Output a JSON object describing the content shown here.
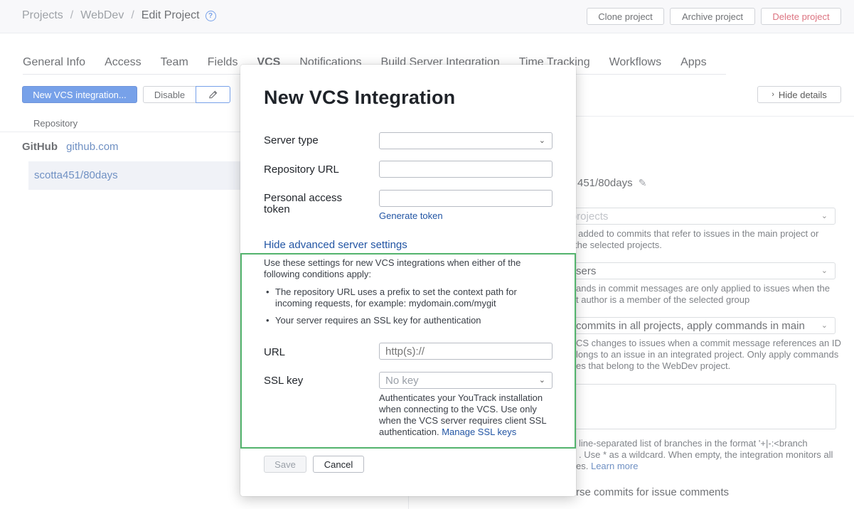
{
  "breadcrumb": {
    "projects": "Projects",
    "project": "WebDev",
    "current": "Edit Project"
  },
  "top_actions": {
    "clone": "Clone project",
    "archive": "Archive project",
    "delete": "Delete project"
  },
  "tabs": [
    "General Info",
    "Access",
    "Team",
    "Fields",
    "VCS",
    "Notifications",
    "Build Server Integration",
    "Time Tracking",
    "Workflows",
    "Apps"
  ],
  "toolbar": {
    "new_vcs": "New VCS integration...",
    "disable": "Disable",
    "hide_details": "Hide details"
  },
  "repo_list": {
    "header": "Repository",
    "group_name": "GitHub",
    "group_host": "github.com",
    "selected_repo": "scotta451/80days"
  },
  "details": {
    "repo_name_partial": "451/80days",
    "projects_placeholder": "ct projects",
    "projects_help_1": "re added to commits that refer to issues in the main project or",
    "projects_help_2": "the selected projects.",
    "users_value": "sers",
    "users_help_1": "ands in commit messages are only applied to issues when the",
    "users_help_2": "t author is a member of the selected group",
    "commits_value": "commits in all projects, apply commands in main",
    "commits_help_1": "CS changes to issues when a commit message references an ID",
    "commits_help_2": "longs to an issue in an integrated project. Only apply commands",
    "commits_help_3": "es that belong to the WebDev project.",
    "branches_help_1": "line-separated list of branches in the format '+|-:<branch",
    "branches_help_2": ". Use * as a wildcard. When empty, the integration monitors all",
    "branches_help_3": "es.",
    "learn_more": "Learn more",
    "parse_commits": "rse commits for issue comments"
  },
  "dialog": {
    "title": "New VCS Integration",
    "server_type_label": "Server type",
    "server_type_value": "",
    "repo_url_label": "Repository URL",
    "repo_url_value": "",
    "token_label": "Personal access token",
    "token_value": "",
    "generate_token": "Generate token",
    "hide_advanced": "Hide advanced server settings",
    "advanced_desc": "Use these settings for new VCS integrations when either of the following conditions apply:",
    "bullets": [
      "The repository URL uses a prefix to set the context path for incoming requests, for example: mydomain.com/mygit",
      "Your server requires an SSL key for authentication"
    ],
    "url_label": "URL",
    "url_placeholder": "http(s)://",
    "ssl_label": "SSL key",
    "ssl_value": "No key",
    "ssl_desc": "Authenticates your YouTrack installation when connecting to the VCS. Use only when the VCS server requires client SSL authentication.",
    "manage_ssl": "Manage SSL keys",
    "save": "Save",
    "cancel": "Cancel"
  },
  "colors": {
    "accent": "#2f6fde",
    "link": "#2255a4",
    "danger": "#c9283c",
    "highlight_border": "#53b36d"
  }
}
